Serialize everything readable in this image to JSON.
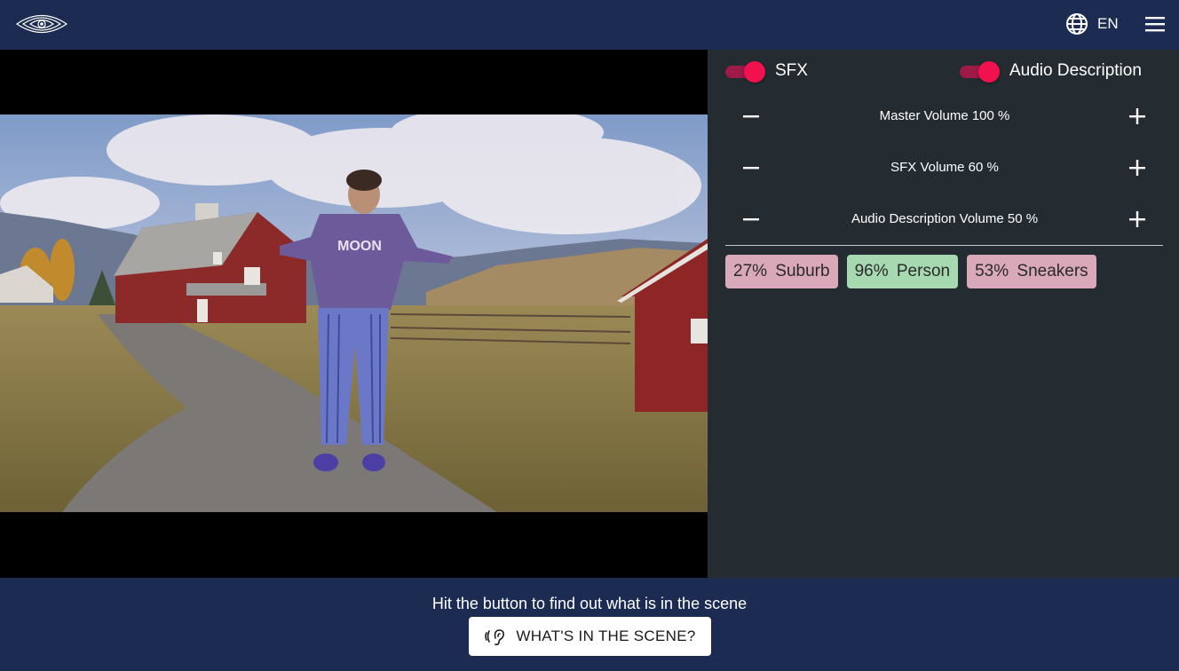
{
  "header": {
    "language": "EN",
    "icons": {
      "logo": "eye-logo",
      "language": "globe-icon",
      "menu": "hamburger-menu-icon"
    }
  },
  "video": {
    "sweater_text": "MOON"
  },
  "panel": {
    "toggles": [
      {
        "label": "SFX",
        "on": true
      },
      {
        "label": "Audio Description",
        "on": true
      }
    ],
    "volumes": [
      {
        "label": "Master Volume 100 %"
      },
      {
        "label": "SFX Volume 60 %"
      },
      {
        "label": "Audio Description Volume 50 %"
      }
    ],
    "tags": [
      {
        "text": "27% Suburb",
        "color": "#d9a9b9"
      },
      {
        "text": "96% Person",
        "color": "#a7d9b1"
      },
      {
        "text": "53% Sneakers",
        "color": "#d9a9b9"
      }
    ],
    "accent_color": "#f0114e"
  },
  "footer": {
    "hint": "Hit the button to find out what is in the scene",
    "button_label": "WHAT'S IN THE SCENE?",
    "button_icon": "ear-audio-icon"
  }
}
